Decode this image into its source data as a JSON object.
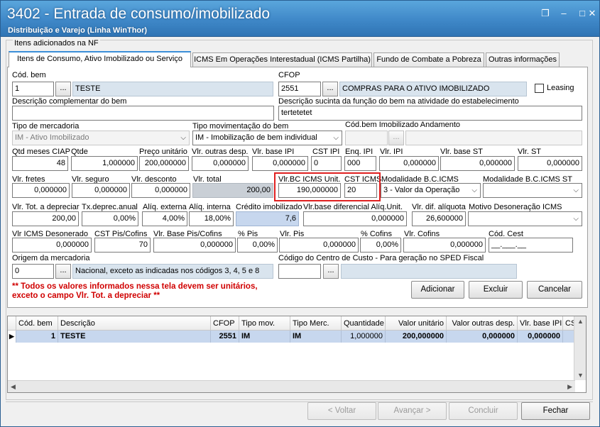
{
  "window": {
    "title": "3402 - Entrada de consumo/imobilizado",
    "subtitle": "Distribuição e Varejo (Linha WinThor)"
  },
  "group_label": "Itens adicionados na NF",
  "tabs": [
    "Itens de Consumo,  Ativo Imobilizado ou Serviço",
    "ICMS Em Operações Interestadual (ICMS Partilha)",
    "Fundo de Combate a Pobreza",
    "Outras informações"
  ],
  "form": {
    "cod_bem": {
      "label": "Cód. bem",
      "value": "1",
      "desc": "TESTE"
    },
    "cfop": {
      "label": "CFOP",
      "value": "2551",
      "desc": "COMPRAS PARA O ATIVO IMOBILIZADO"
    },
    "leasing": {
      "label": "Leasing",
      "checked": false
    },
    "desc_complementar": {
      "label": "Descrição complementar do bem",
      "value": ""
    },
    "desc_sucinta": {
      "label": "Descrição sucinta da função do bem na atividade do estabelecimento",
      "value": "tertetetet"
    },
    "tipo_mercadoria": {
      "label": "Tipo de mercadoria",
      "value": "IM - Ativo Imobilizado"
    },
    "tipo_mov": {
      "label": "Tipo movimentação do bem",
      "value": "IM - Imobilização de bem individual"
    },
    "cod_bem_andamento": {
      "label": "Cód.bem Imobilizado Andamento",
      "value": ""
    },
    "row4": [
      {
        "label": "Qtd meses CIAP",
        "value": "48"
      },
      {
        "label": "Qtde",
        "value": "1,000000"
      },
      {
        "label": "Preço unitário",
        "value": "200,000000"
      },
      {
        "label": "Vlr. outras desp.",
        "value": "0,000000"
      },
      {
        "label": "Vlr. base IPI",
        "value": "0,000000"
      },
      {
        "label": "CST IPI",
        "value": "0"
      },
      {
        "label": "Enq. IPI",
        "value": "000"
      },
      {
        "label": "Vlr. IPI",
        "value": "0,000000"
      },
      {
        "label": "Vlr. base ST",
        "value": "0,000000"
      },
      {
        "label": "Vlr. ST",
        "value": "0,000000"
      }
    ],
    "row5": {
      "vlr_fretes": {
        "label": "Vlr. fretes",
        "value": "0,000000"
      },
      "vlr_seguro": {
        "label": "Vlr. seguro",
        "value": "0,000000"
      },
      "vlr_desconto": {
        "label": "Vlr. desconto",
        "value": "0,000000"
      },
      "vlr_total": {
        "label": "Vlr. total",
        "value": "200,00"
      },
      "vlr_bc_icms": {
        "label": "Vlr.BC ICMS Unit.",
        "value": "190,000000"
      },
      "cst_icms": {
        "label": "CST ICMS",
        "value": "20"
      },
      "modalidade_bc": {
        "label": "Modalidade B.C.ICMS",
        "value": "3 - Valor da Operação"
      },
      "modalidade_bc_st": {
        "label": "Modalidade B.C.ICMS ST",
        "value": ""
      }
    },
    "row6": {
      "vlr_tot_depreciar": {
        "label": "Vlr. Tot. a depreciar",
        "value": "200,00"
      },
      "tx_deprec": {
        "label": "Tx.deprec.anual",
        "value": "0,00%"
      },
      "aliq_externa": {
        "label": "Alíq. externa",
        "value": "4,00%"
      },
      "aliq_interna": {
        "label": "Alíq. interna",
        "value": "18,00%"
      },
      "credito_imob": {
        "label": "Crédito imobilizado",
        "value": "7,6"
      },
      "vlr_base_dif": {
        "label": "Vlr.base diferencial Alíq.Unit.",
        "value": "0,000000"
      },
      "vlr_dif_aliquota": {
        "label": "Vlr. dif. alíquota",
        "value": "26,600000"
      },
      "motivo_deson": {
        "label": "Motivo Desoneração ICMS",
        "value": ""
      }
    },
    "row7": {
      "vlr_icms_deson": {
        "label": "Vlr ICMS Desonerado",
        "value": "0,000000"
      },
      "cst_pis": {
        "label": "CST Pis/Cofins",
        "value": "70"
      },
      "vlr_base_pis": {
        "label": "Vlr. Base Pis/Cofins",
        "value": "0,000000"
      },
      "perc_pis": {
        "label": "% Pis",
        "value": "0,00%"
      },
      "vlr_pis": {
        "label": "Vlr. Pis",
        "value": "0,000000"
      },
      "perc_cofins": {
        "label": "% Cofins",
        "value": "0,00%"
      },
      "vlr_cofins": {
        "label": "Vlr. Cofins",
        "value": "0,000000"
      },
      "cod_cest": {
        "label": "Cód. Cest",
        "value": "__.___.__"
      }
    },
    "origem": {
      "label": "Origem da mercadoria",
      "value": "0",
      "desc": "Nacional, exceto as indicadas nos códigos 3, 4, 5 e 8"
    },
    "centro_custo": {
      "label": "Código do Centro de Custo - Para geração no SPED Fiscal",
      "value": "",
      "desc": ""
    },
    "warning_line1": "** Todos os valores informados nessa tela devem ser unitários,",
    "warning_line2": "exceto o campo Vlr. Tot. a depreciar **",
    "ellipsis": "..."
  },
  "actions": {
    "adicionar": "Adicionar",
    "excluir": "Excluir",
    "cancelar": "Cancelar"
  },
  "grid": {
    "columns": [
      "Cód. bem",
      "Descrição",
      "CFOP",
      "Tipo mov.",
      "Tipo Merc.",
      "Quantidade",
      "Valor unitário",
      "Valor outras desp.",
      "Vlr. base IPI",
      "CST I"
    ],
    "rows": [
      [
        "1",
        "TESTE",
        "2551",
        "IM",
        "IM",
        "1,000000",
        "200,000000",
        "0,000000",
        "0,000000",
        ""
      ]
    ]
  },
  "wizard": {
    "voltar": "< Voltar",
    "avancar": "Avançar >",
    "concluir": "Concluir",
    "fechar": "Fechar"
  }
}
